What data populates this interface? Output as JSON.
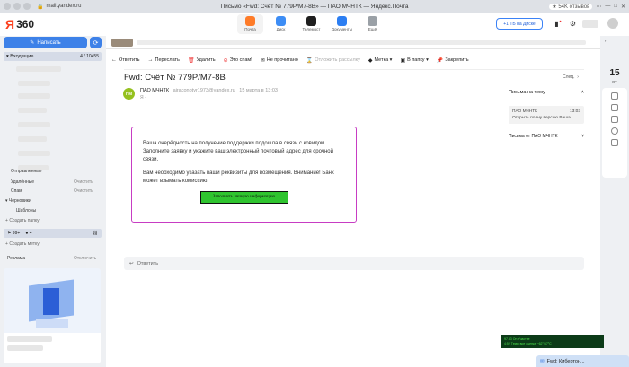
{
  "browser": {
    "url": "mail.yandex.ru",
    "tab_title": "Письмо «Fwd: Счёт № 779Р/М7-8В» — ПАО МЧНТК — Яндекс.Почта",
    "reviews_badge": "★ 54K отзывов"
  },
  "header": {
    "logo_ya": "Я",
    "logo_360": "360",
    "apps": [
      {
        "label": "Почта",
        "color": "#fe7b28"
      },
      {
        "label": "Диск",
        "color": "#3d8df5"
      },
      {
        "label": "Телемост",
        "color": "#1f1f1f"
      },
      {
        "label": "Документы",
        "color": "#2c7ef2"
      },
      {
        "label": "Ещё",
        "color": "#9aa0a6"
      }
    ],
    "disk_button": "+1 ТБ на Диске"
  },
  "sidebar": {
    "compose_label": "Написать",
    "inbox_label": "Входящие",
    "inbox_count": "4 / 10455",
    "folders": [
      {
        "label": "Отправленные",
        "action": ""
      },
      {
        "label": "Удалённые",
        "action": "Очистить"
      },
      {
        "label": "Спам",
        "action": "Очистить"
      },
      {
        "label": "Черновики",
        "action": ""
      },
      {
        "label": "Шаблоны",
        "action": ""
      }
    ],
    "create_folder": "Создать папку",
    "tags": {
      "flag_count": "99+",
      "dot_count": "4"
    },
    "create_label": "Создать метку",
    "ad_label": "Реклама",
    "ad_disable": "Отключить"
  },
  "toolbar": {
    "items": [
      {
        "icon": "←",
        "label": "Ответить"
      },
      {
        "icon": "→",
        "label": "Переслать"
      },
      {
        "icon": "🗑",
        "label": "Удалить"
      },
      {
        "icon": "⊘",
        "label": "Это спам!"
      },
      {
        "icon": "✉",
        "label": "Не прочитано"
      },
      {
        "icon": "⌛",
        "label": "Отложить рассылку"
      },
      {
        "icon": "◆",
        "label": "Метка ▾"
      },
      {
        "icon": "▣",
        "label": "В папку ▾"
      },
      {
        "icon": "📌",
        "label": "Закрепить"
      }
    ]
  },
  "message": {
    "subject": "Fwd: Счёт № 779Р/М7-8В",
    "next_label": "След.",
    "avatar_initials": "ПМ",
    "sender_name": "ПАО МЧНТК",
    "sender_email": "airaconotyr1973@yandex.ru",
    "date": "15 марта в 13:03",
    "to_line": "Я ·",
    "body_p1": "Ваша очерёдность на получение поддержки подошла в связи с ковидом. Заполните заявку и укажите ваш электронный почтовый адрес для срочной связи.",
    "body_p2": "Вам необходимо указать ваши реквизиты для возмещения. Внимание! Банк может взымать комиссию.",
    "cta_label": "Заполнить личную информацию",
    "reply_label": "Ответить"
  },
  "thread": {
    "header": "Письма на тему",
    "item_sender": "ПАО МЧНТК",
    "item_time": "13:03",
    "item_preview": "Открыть полну версию Ваша...",
    "other": "Письма от ПАО МЧНТК"
  },
  "rail": {
    "date": "15",
    "weekday": "ВТ"
  },
  "status_widget": {
    "line1": "97.83    On  Участие",
    "line2": "4:52   Темы  вое оценка ~62°/67°С"
  },
  "notification": {
    "label": "Fwd: Кибертон..."
  }
}
